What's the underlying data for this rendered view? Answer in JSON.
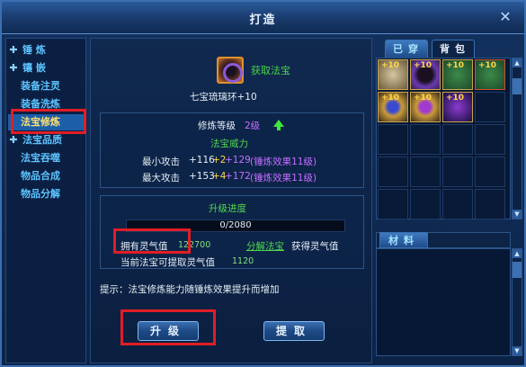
{
  "window": {
    "title": "打造"
  },
  "menu": {
    "items": [
      {
        "label": "锤  炼",
        "expandable": true
      },
      {
        "label": "镶  嵌",
        "expandable": true
      },
      {
        "label": "装备注灵",
        "expandable": false
      },
      {
        "label": "装备洗炼",
        "expandable": false
      },
      {
        "label": "法宝修炼",
        "expandable": false,
        "active": true
      },
      {
        "label": "法宝品质",
        "expandable": true
      },
      {
        "label": "法宝吞噬",
        "expandable": false
      },
      {
        "label": "物品合成",
        "expandable": false
      },
      {
        "label": "物品分解",
        "expandable": false
      }
    ]
  },
  "main": {
    "get_link": "获取法宝",
    "item_name": "七宝琉璃环+10",
    "refine_level_label": "修炼等级",
    "refine_level_value": "2级",
    "power_title": "法宝威力",
    "min_attack_label": "最小攻击",
    "min_base": "+116",
    "min_bonus": "+2",
    "min_next": "+129",
    "min_effect": "(锤炼效果11级)",
    "max_attack_label": "最大攻击",
    "max_base": "+153",
    "max_bonus": "+4",
    "max_next": "+172",
    "max_effect": "(锤炼效果11级)",
    "progress_title": "升级进度",
    "progress_text": "0/2080",
    "progress_fraction": 0,
    "own_spirit_label": "拥有灵气值",
    "own_spirit_value": "122700",
    "decompose_link": "分解法宝",
    "gain_spirit_label": "获得灵气值",
    "extract_label": "当前法宝可提取灵气值",
    "extract_value": "1120",
    "hint": "提示：法宝修炼能力随锤炼效果提升而增加",
    "upgrade_button": "升级",
    "extract_button": "提取"
  },
  "inventory": {
    "tab_worn": "已穿",
    "tab_bag": "背包",
    "items": [
      {
        "plus": "+10",
        "icon": "scroll-icon"
      },
      {
        "plus": "+10",
        "icon": "ring-icon"
      },
      {
        "plus": "+10",
        "icon": "chest-icon"
      },
      {
        "plus": "+10",
        "icon": "chest-icon"
      },
      {
        "plus": "+10",
        "icon": "amulet-icon"
      },
      {
        "plus": "+10",
        "icon": "amulet-icon"
      },
      {
        "plus": "+10",
        "icon": "dragon-icon"
      }
    ],
    "materials_tab": "材料"
  },
  "colors": {
    "highlight_red": "#e01e25",
    "menu_text": "#5cc4ff",
    "active_menu_text": "#ffe070",
    "green_text": "#4fd84f",
    "purple_text": "#c46eff"
  }
}
